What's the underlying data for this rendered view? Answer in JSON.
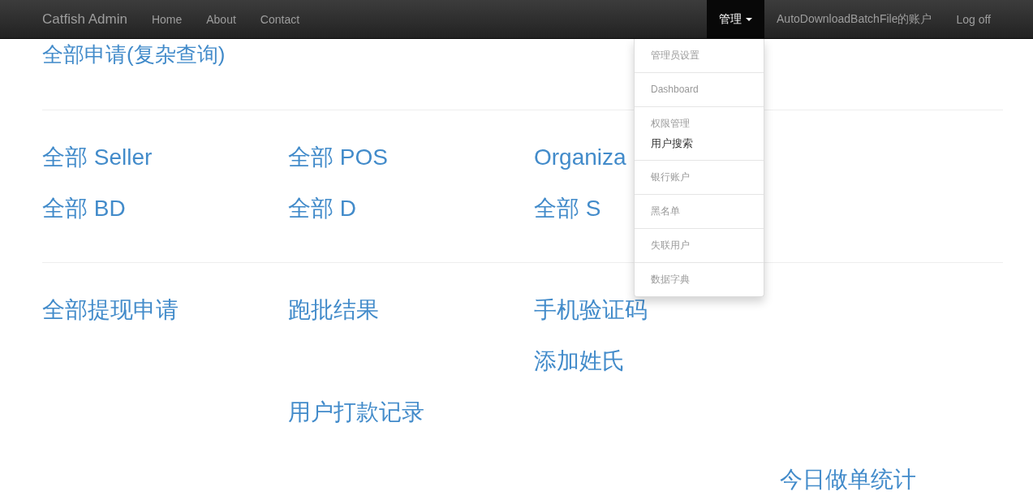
{
  "navbar": {
    "brand": "Catfish Admin",
    "links": [
      {
        "label": "Home"
      },
      {
        "label": "About"
      },
      {
        "label": "Contact"
      }
    ],
    "right": [
      {
        "label": "管理",
        "kind": "dropdown",
        "selected": true
      },
      {
        "label": "AutoDownloadBatchFile的账户",
        "kind": "link",
        "selected": false
      },
      {
        "label": "Log off",
        "kind": "link",
        "selected": false
      }
    ]
  },
  "dropdown_menu": [
    {
      "items": [
        {
          "label": "管理员设置",
          "kind": "header"
        }
      ]
    },
    {
      "items": [
        {
          "label": "Dashboard",
          "kind": "header"
        }
      ]
    },
    {
      "items": [
        {
          "label": "权限管理",
          "kind": "header"
        },
        {
          "label": "用户搜索",
          "kind": "link"
        }
      ]
    },
    {
      "items": [
        {
          "label": "银行账户",
          "kind": "header"
        }
      ]
    },
    {
      "items": [
        {
          "label": "黑名单",
          "kind": "header"
        }
      ]
    },
    {
      "items": [
        {
          "label": "失联用户",
          "kind": "header"
        }
      ]
    },
    {
      "items": [
        {
          "label": "数据字典",
          "kind": "header"
        }
      ]
    }
  ],
  "sections": [
    {
      "rows": [
        [
          "全部申请(复杂查询)",
          null,
          null,
          null
        ]
      ]
    },
    {
      "rows": [
        [
          "全部 Seller",
          "全部 POS",
          "Organiza",
          null
        ],
        [
          "全部 BD",
          "全部 D",
          "全部 S",
          null
        ]
      ]
    },
    {
      "rows": [
        [
          "全部提现申请",
          "跑批结果",
          "手机验证码",
          null
        ],
        [
          null,
          null,
          "添加姓氏",
          null
        ],
        [
          null,
          "用户打款记录",
          null,
          null
        ],
        [
          null,
          null,
          null,
          "今日做单统计"
        ]
      ]
    }
  ]
}
